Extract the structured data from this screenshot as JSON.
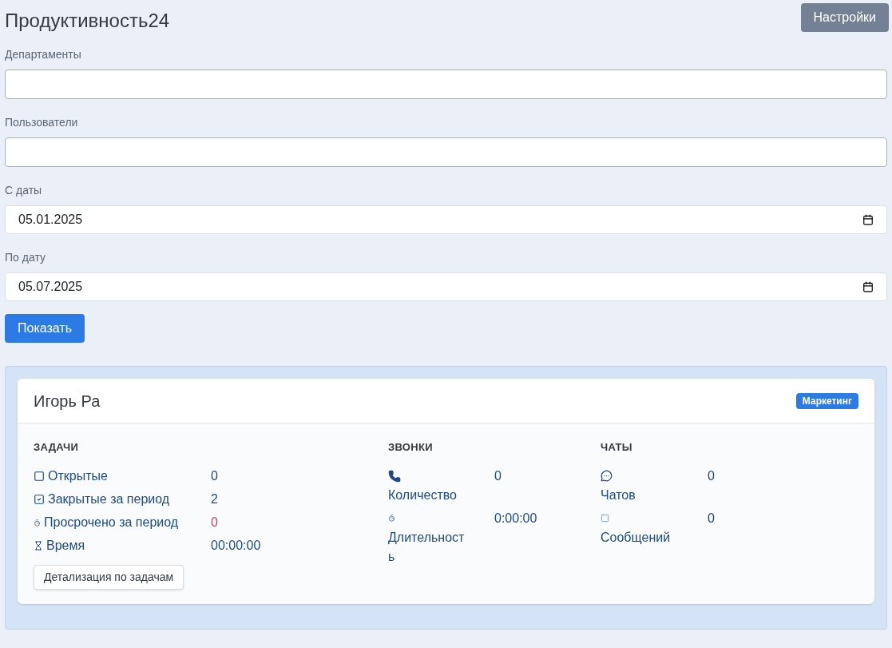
{
  "title": "Продуктивность24",
  "settings_button": "Настройки",
  "filters": [
    {
      "kind": "text",
      "label": "Департаменты"
    },
    {
      "kind": "text",
      "label": "Пользователи"
    },
    {
      "kind": "date",
      "label": "С даты",
      "value": "05.01.2025"
    },
    {
      "kind": "date",
      "label": "По дату",
      "value": "05.07.2025"
    }
  ],
  "show_button": "Показать",
  "card": {
    "name": "Игорь Ра",
    "badge": "Маркетинг",
    "sections": [
      {
        "title": "ЗАДАЧИ",
        "rows": [
          {
            "label": "Открытые",
            "value": "0",
            "overdue": false
          },
          {
            "label": "Закрытые за период",
            "value": "2",
            "overdue": false
          },
          {
            "label": "Просрочено за период",
            "value": "0",
            "overdue": true
          },
          {
            "label": "Время",
            "value": "00:00:00",
            "overdue": false
          }
        ],
        "button": "Детализация по задачам"
      },
      {
        "title": "ЗВОНКИ",
        "rows": [
          {
            "label": "Количество",
            "value": "0",
            "overdue": false
          },
          {
            "label": "Длительность",
            "value": "0:00:00",
            "overdue": false
          }
        ]
      },
      {
        "title": "ЧАТЫ",
        "rows": [
          {
            "label": "Чатов",
            "value": "0",
            "overdue": false
          },
          {
            "label": "Сообщений",
            "value": "0",
            "overdue": false
          }
        ]
      }
    ]
  }
}
